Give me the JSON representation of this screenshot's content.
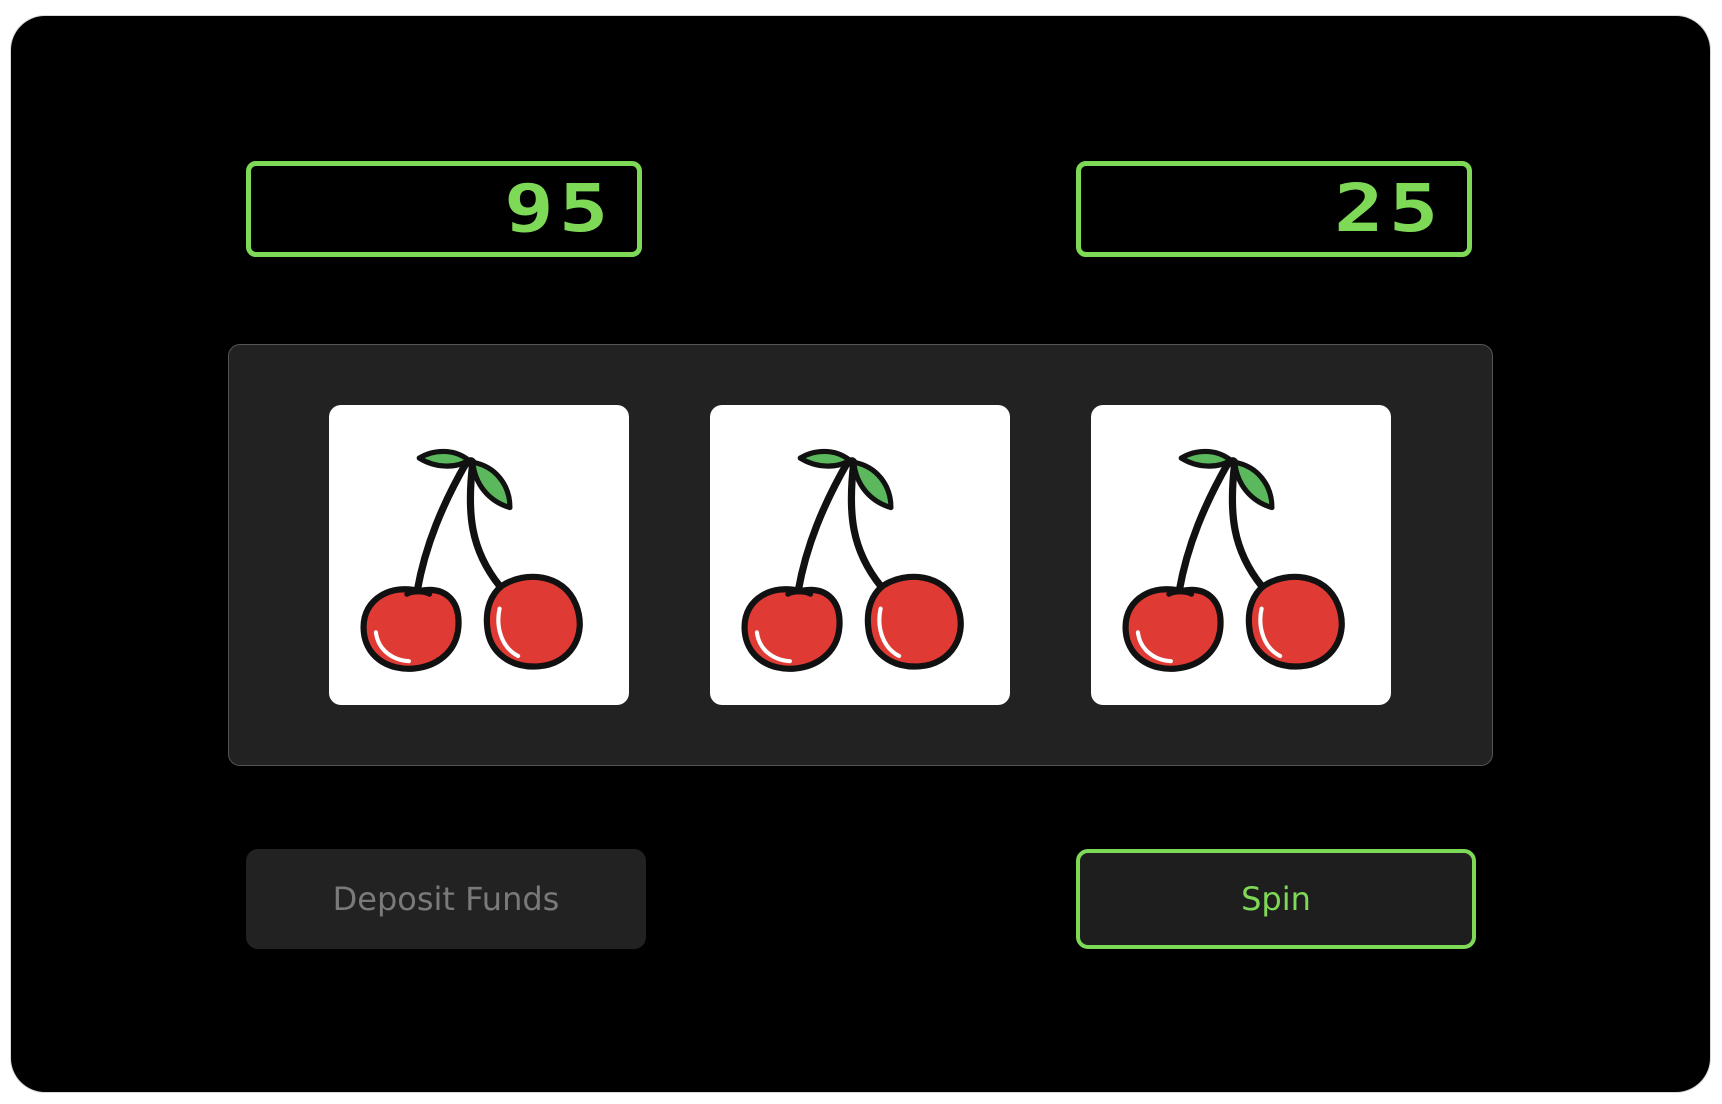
{
  "displays": {
    "balance": "95",
    "bet": "25"
  },
  "reels": [
    {
      "symbol": "cherry-icon"
    },
    {
      "symbol": "cherry-icon"
    },
    {
      "symbol": "cherry-icon"
    }
  ],
  "buttons": {
    "deposit_label": "Deposit Funds",
    "spin_label": "Spin"
  },
  "colors": {
    "accent": "#7ed957",
    "panel": "#222222",
    "cherry": "#e03a34",
    "leaf": "#5cb85c"
  }
}
